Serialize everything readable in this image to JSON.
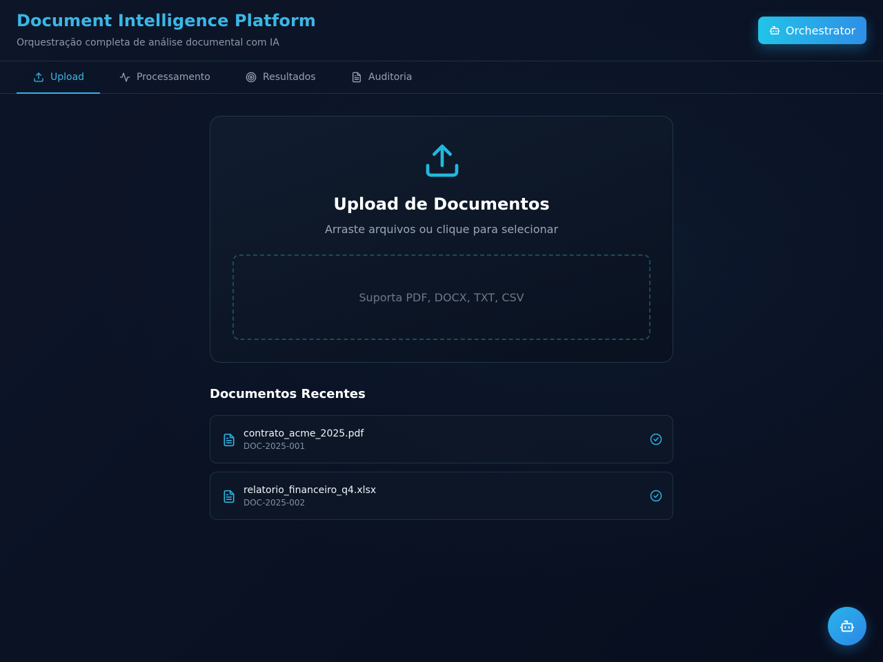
{
  "header": {
    "title": "Document Intelligence Platform",
    "subtitle": "Orquestração completa de análise documental com IA",
    "orchestrator_label": "Orchestrator",
    "orchestrator_icon": "bot-icon"
  },
  "tabs": [
    {
      "label": "Upload",
      "icon": "upload-icon",
      "active": true
    },
    {
      "label": "Processamento",
      "icon": "activity-icon",
      "active": false
    },
    {
      "label": "Resultados",
      "icon": "target-icon",
      "active": false
    },
    {
      "label": "Auditoria",
      "icon": "file-text-icon",
      "active": false
    }
  ],
  "upload": {
    "icon": "upload-icon",
    "title": "Upload de Documentos",
    "subtitle": "Arraste arquivos ou clique para selecionar",
    "dropzone_text": "Suporta PDF, DOCX, TXT, CSV"
  },
  "recent": {
    "title": "Documentos Recentes",
    "items": [
      {
        "name": "contrato_acme_2025.pdf",
        "id": "DOC-2025-001",
        "status_icon": "check-circle-icon"
      },
      {
        "name": "relatorio_financeiro_q4.xlsx",
        "id": "DOC-2025-002",
        "status_icon": "check-circle-icon"
      }
    ]
  },
  "fab": {
    "icon": "bot-icon"
  },
  "colors": {
    "accent": "#3ab7e6",
    "background": "#0a1224",
    "border": "#1b3340"
  }
}
